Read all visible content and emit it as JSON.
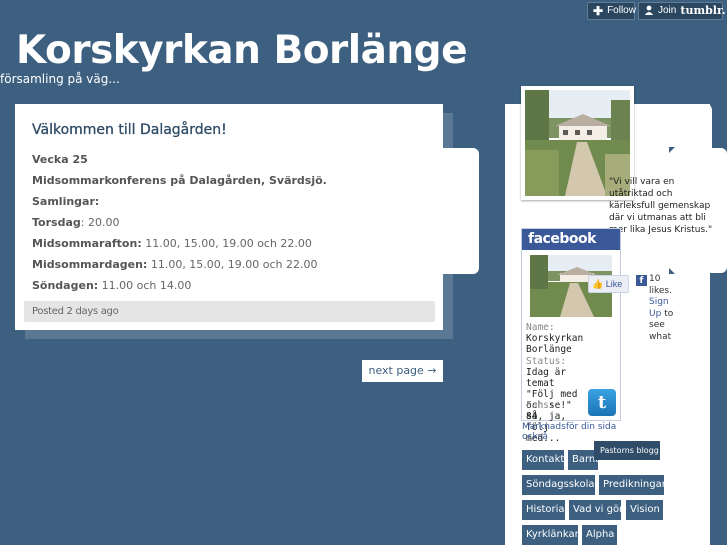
{
  "tumblr": {
    "follow_label": "Follow",
    "join_label": "Join",
    "join_brand": "tumblr."
  },
  "site": {
    "title": "Korskyrkan Borlänge",
    "tagline": "församling på väg..."
  },
  "post": {
    "title": "Välkommen till Dalagården!",
    "week": "Vecka 25",
    "conference": "Midsommarkonferens på Dalagården, Svärdsjö.",
    "gatherings_label": "Samlingar:",
    "schedule": [
      {
        "day": "Torsdag",
        "sep": ": ",
        "times": "20.00"
      },
      {
        "day": "Midsommarafton:",
        "sep": " ",
        "times": "11.00, 15.00, 19.00 och 22.00"
      },
      {
        "day": "Midsommardagen:",
        "sep": " ",
        "times": "11.00, 15.00, 19.00 och 22.00"
      },
      {
        "day": "Söndagen:",
        "sep": " ",
        "times": "11.00 och 14.00"
      }
    ],
    "posted": "Posted 2 days ago"
  },
  "pagination": {
    "next_label": "next page →"
  },
  "sidebar": {
    "quote": "\"Vi vill vara en utåtriktad och kärleksfull gemenskap där vi utmanas att bli mer lika Jesus Kristus.\"",
    "facebook": {
      "brand": "facebook",
      "name_key": "Name:",
      "name_value": "Korskyrkan Borlänge",
      "status_key": "Status:",
      "status_value": "Idag är temat \"Följ med och se!\" så, ja, följ med...",
      "fans_key": "Fans:",
      "fans_value": "84",
      "like_label": "Like",
      "likes_count": "10 likes.",
      "signup_link": "Sign Up",
      "signup_rest": "to see what",
      "promote": "Marknadsför din sida också"
    },
    "nav": [
      "Kontakt",
      "Barnaktivitet",
      "Söndagsskola",
      "Predikningar",
      "Historia",
      "Vad vi gör",
      "Vision",
      "Kyrklänkar",
      "Alpha"
    ],
    "dropdown_label": "Pastorns blogg"
  },
  "colors": {
    "background": "#3d6081",
    "facebook_blue": "#3b5998",
    "twitter_blue": "#1b73b5"
  }
}
